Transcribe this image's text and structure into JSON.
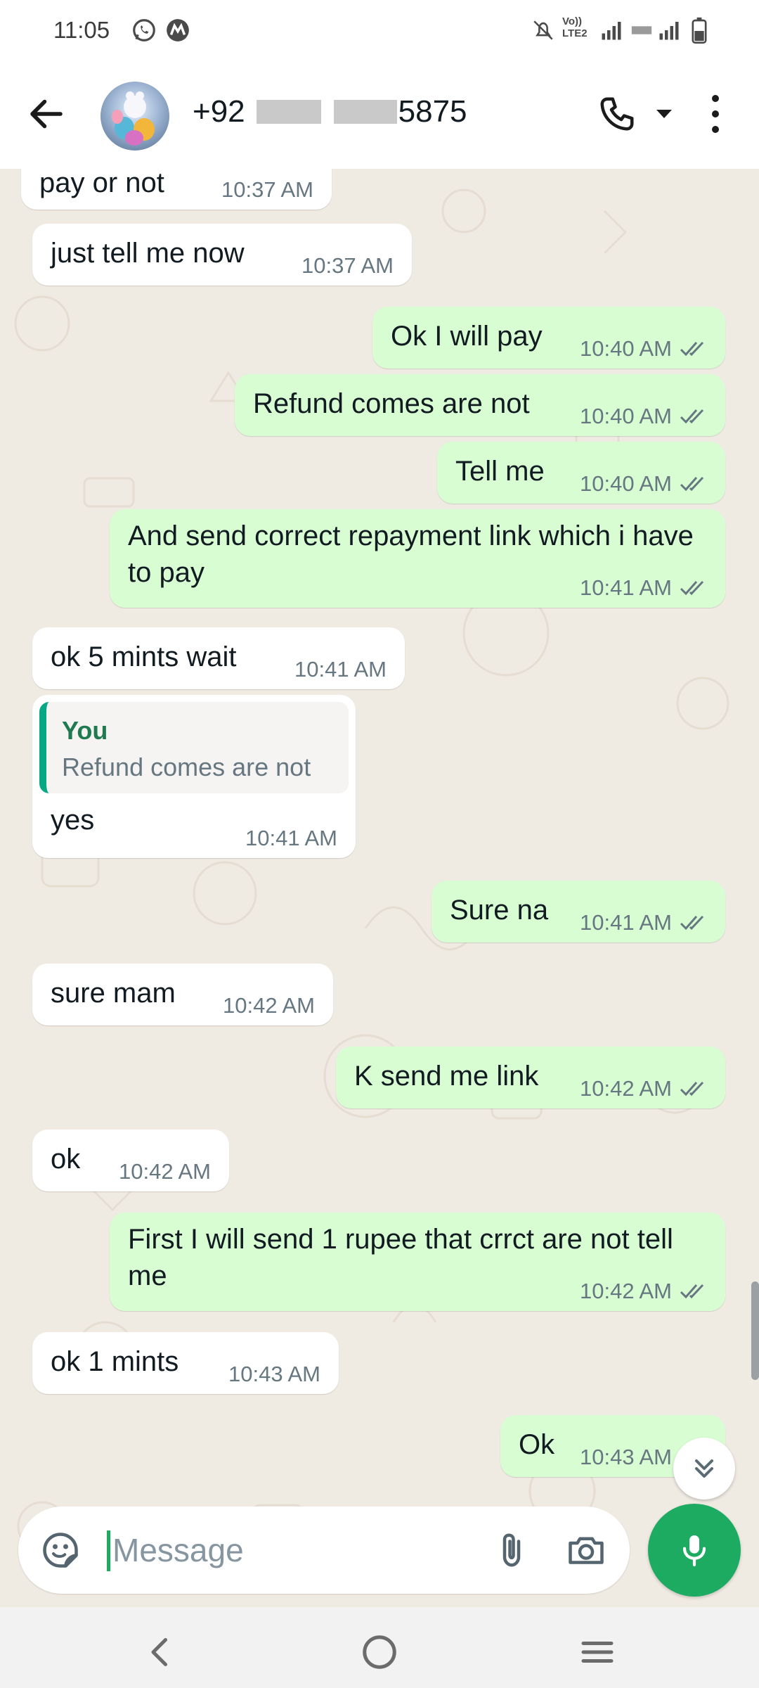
{
  "status_bar": {
    "time": "11:05",
    "left_icons": [
      "whatsapp-icon",
      "app-m-icon"
    ],
    "right_icons": [
      "mute-bell-icon",
      "volte-icon",
      "signal-icon",
      "signal-icon",
      "battery-icon"
    ],
    "volte_label_1": "Vo))",
    "volte_label_2": "LTE2"
  },
  "header": {
    "contact_prefix": "+92",
    "contact_suffix": "5875",
    "icons": [
      "back-arrow-icon",
      "avatar",
      "phone-icon",
      "caret-down-icon",
      "more-vert-icon"
    ]
  },
  "messages": [
    {
      "dir": "in",
      "text": "pay or not",
      "time": "10:37 AM"
    },
    {
      "dir": "in",
      "text": "just tell me now",
      "time": "10:37 AM"
    },
    {
      "dir": "out",
      "text": "Ok I will pay",
      "time": "10:40 AM"
    },
    {
      "dir": "out",
      "text": "Refund comes are not",
      "time": "10:40 AM"
    },
    {
      "dir": "out",
      "text": "Tell me",
      "time": "10:40 AM"
    },
    {
      "dir": "out",
      "text": "And send correct repayment link which i have to pay",
      "time": "10:41 AM"
    },
    {
      "dir": "in",
      "text": "ok 5 mints wait",
      "time": "10:41 AM"
    },
    {
      "dir": "in",
      "text": "yes",
      "time": "10:41 AM",
      "quote": {
        "author": "You",
        "text": "Refund comes are not"
      }
    },
    {
      "dir": "out",
      "text": "Sure na",
      "time": "10:41 AM"
    },
    {
      "dir": "in",
      "text": "sure mam",
      "time": "10:42 AM"
    },
    {
      "dir": "out",
      "text": "K send me link",
      "time": "10:42 AM"
    },
    {
      "dir": "in",
      "text": "ok",
      "time": "10:42 AM"
    },
    {
      "dir": "out",
      "text": "First I will send 1 rupee that crrct are not tell me",
      "time": "10:42 AM"
    },
    {
      "dir": "in",
      "text": "ok 1 mints",
      "time": "10:43 AM"
    },
    {
      "dir": "out",
      "text": "Ok",
      "time": "10:43 AM"
    }
  ],
  "composer": {
    "placeholder": "Message",
    "value": ""
  },
  "colors": {
    "outgoing_bubble": "#d9fdd3",
    "incoming_bubble": "#ffffff",
    "chat_background": "#efeae2",
    "accent_green": "#1daa61",
    "read_ticks": "#667781"
  },
  "nav_bar": {
    "icons": [
      "nav-back-icon",
      "nav-home-icon",
      "nav-recents-icon"
    ]
  }
}
